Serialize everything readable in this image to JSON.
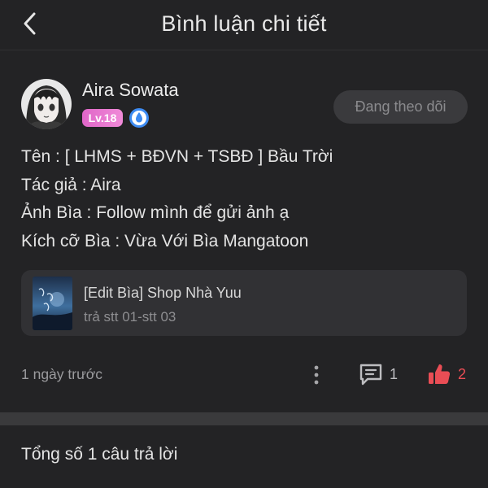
{
  "header": {
    "title": "Bình luận chi tiết",
    "back_icon": "chevron-left-icon"
  },
  "comment": {
    "username": "Aira Sowata",
    "level": "Lv.18",
    "badge_icon": "water-drop-badge-icon",
    "follow_label": "Đang theo dõi",
    "lines": [
      "Tên : [ LHMS + BĐVN + TSBĐ ] Bầu Trời",
      "Tác giả : Aira",
      "Ảnh Bìa : Follow mình để gửi ảnh ạ",
      "Kích cỡ Bìa : Vừa Với Bìa Mangatoon"
    ],
    "linked_work": {
      "title": "[Edit Bìa] Shop Nhà Yuu",
      "subtitle": "trả stt 01-stt 03"
    },
    "time": "1 ngày trước",
    "reply_count": "1",
    "like_count": "2"
  },
  "footer": {
    "total_replies": "Tổng số 1 câu trả lời"
  },
  "colors": {
    "background": "#232325",
    "card": "#313134",
    "like_accent": "#ea4d55",
    "level_badge": "#e066c8",
    "verified_badge": "#3d8bf2"
  }
}
